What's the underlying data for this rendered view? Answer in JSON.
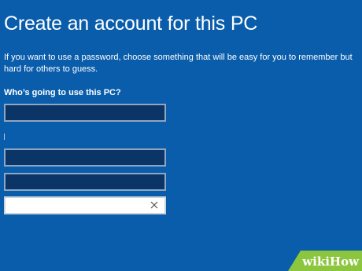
{
  "page": {
    "title": "Create an account for this PC",
    "description": "If you want to use a password, choose something that will be easy for you to remember but hard for others to guess.",
    "user_section_label": "Who’s going to use this PC?"
  },
  "form": {
    "username": {
      "value": "",
      "placeholder": ""
    },
    "password": {
      "value": "",
      "placeholder": ""
    },
    "reenter_password": {
      "value": "",
      "placeholder": ""
    },
    "password_hint": {
      "value": "",
      "placeholder": ""
    }
  },
  "icons": {
    "clear": "close-icon"
  },
  "watermark": {
    "text": "wikiHow"
  },
  "colors": {
    "background": "#0a5dab",
    "field_dark": "#0b3566",
    "field_border": "#8ea6c2",
    "field_light": "#ffffff",
    "watermark_bg": "#8cc63f"
  }
}
